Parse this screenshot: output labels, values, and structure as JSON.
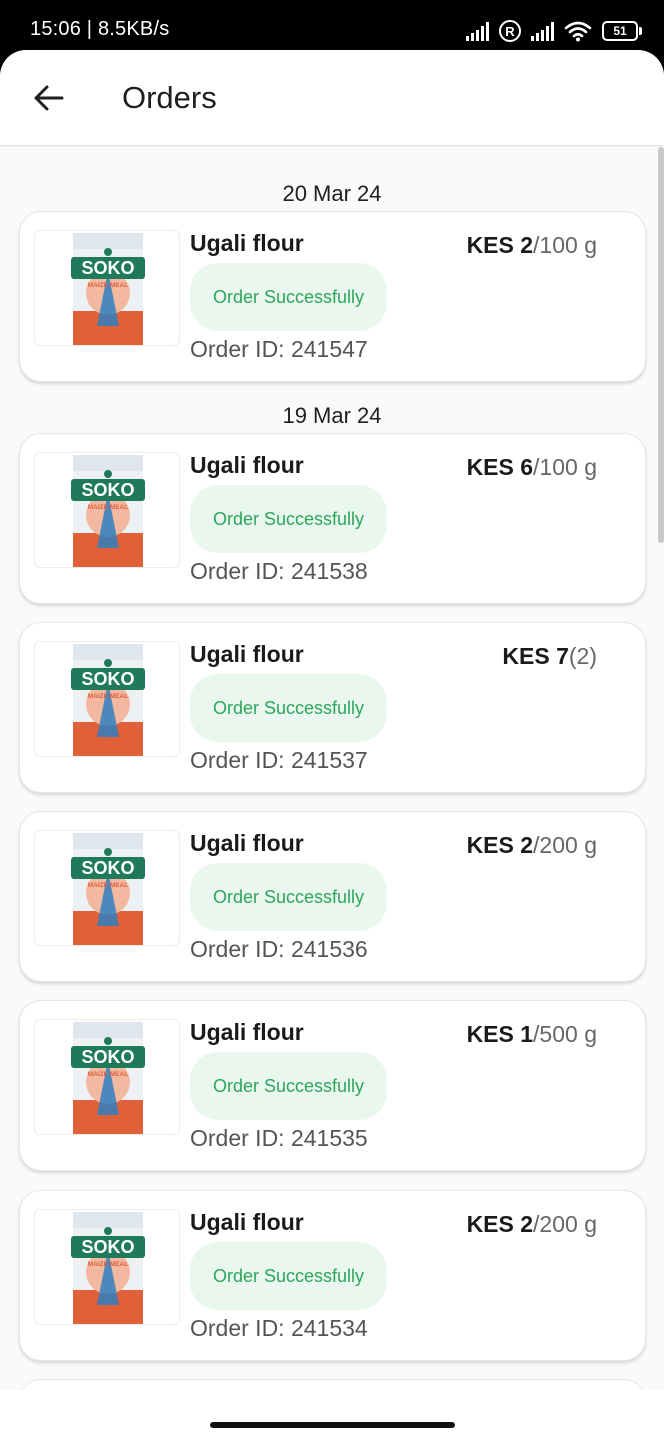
{
  "status_bar": {
    "time_speed": "15:06 | 8.5KB/s",
    "battery_level": "51"
  },
  "header": {
    "title": "Orders"
  },
  "product_image": {
    "brand_text": "SOKO",
    "sub_text": "MAIZE MEAL"
  },
  "groups": [
    {
      "date": "20 Mar 24"
    },
    {
      "date": "19 Mar 24"
    }
  ],
  "orders": [
    {
      "name": "Ugali flour",
      "price": "KES 2",
      "unit": "/100 g",
      "status": "Order Successfully",
      "order_id": "Order ID: 241547"
    },
    {
      "name": "Ugali flour",
      "price": "KES 6",
      "unit": "/100 g",
      "status": "Order Successfully",
      "order_id": "Order ID: 241538"
    },
    {
      "name": "Ugali flour",
      "price": "KES 7",
      "unit": "(2)",
      "status": "Order Successfully",
      "order_id": "Order ID: 241537"
    },
    {
      "name": "Ugali flour",
      "price": "KES 2",
      "unit": "/200 g",
      "status": "Order Successfully",
      "order_id": "Order ID: 241536"
    },
    {
      "name": "Ugali flour",
      "price": "KES 1",
      "unit": "/500 g",
      "status": "Order Successfully",
      "order_id": "Order ID: 241535"
    },
    {
      "name": "Ugali flour",
      "price": "KES 2",
      "unit": "/200 g",
      "status": "Order Successfully",
      "order_id": "Order ID: 241534"
    }
  ],
  "colors": {
    "status_green": "#2da65c",
    "status_bg": "#e9f7ee",
    "brand_green": "#1f7a5a",
    "brand_orange": "#e0603a"
  }
}
